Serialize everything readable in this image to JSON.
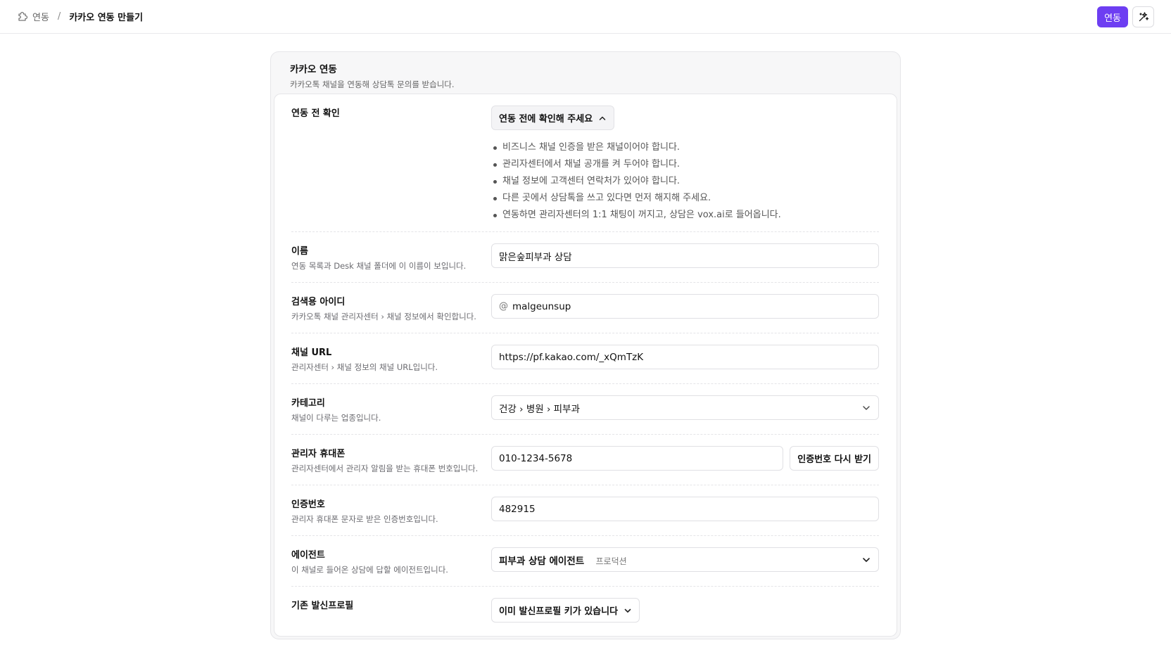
{
  "breadcrumb": {
    "parent": "연동",
    "separator": "/",
    "current": "카카오 연동 만들기"
  },
  "header": {
    "primary_button": "연동",
    "magic_icon": "magic-wand-icon"
  },
  "card": {
    "title": "카카오 연동",
    "subtitle": "카카오톡 채널을 연동해 상담톡 문의를 받습니다."
  },
  "precheck": {
    "label": "연동 전 확인",
    "toggle_label": "연동 전에 확인해 주세요",
    "items": [
      "비즈니스 채널 인증을 받은 채널이어야 합니다.",
      "관리자센터에서 채널 공개를 켜 두어야 합니다.",
      "채널 정보에 고객센터 연락처가 있어야 합니다.",
      "다른 곳에서 상담톡을 쓰고 있다면 먼저 해지해 주세요.",
      "연동하면 관리자센터의 1:1 채팅이 꺼지고, 상담은 vox.ai로 들어옵니다."
    ]
  },
  "fields": {
    "name": {
      "label": "이름",
      "hint": "연동 목록과 Desk 채널 폴더에 이 이름이 보입니다.",
      "value": "맑은숲피부과 상담"
    },
    "search_id": {
      "label": "검색용 아이디",
      "hint": "카카오톡 채널 관리자센터 › 채널 정보에서 확인합니다.",
      "prefix": "@",
      "value": "malgeunsup"
    },
    "channel_url": {
      "label": "채널 URL",
      "hint": "관리자센터 › 채널 정보의 채널 URL입니다.",
      "value": "https://pf.kakao.com/_xQmTzK"
    },
    "category": {
      "label": "카테고리",
      "hint": "채널이 다루는 업종입니다.",
      "value": "건강 › 병원 › 피부과"
    },
    "admin_phone": {
      "label": "관리자 휴대폰",
      "hint": "관리자센터에서 관리자 알림을 받는 휴대폰 번호입니다.",
      "value": "010-1234-5678",
      "resend_button": "인증번호 다시 받기"
    },
    "auth_code": {
      "label": "인증번호",
      "hint": "관리자 휴대폰 문자로 받은 인증번호입니다.",
      "value": "482915"
    },
    "agent": {
      "label": "에이전트",
      "hint": "이 채널로 들어온 상담에 답할 에이전트입니다.",
      "value": "피부과 상담 에이전트",
      "tag": "프로덕션"
    },
    "sender_profile": {
      "label": "기존 발신프로필",
      "value": "이미 발신프로필 키가 있습니다"
    }
  }
}
